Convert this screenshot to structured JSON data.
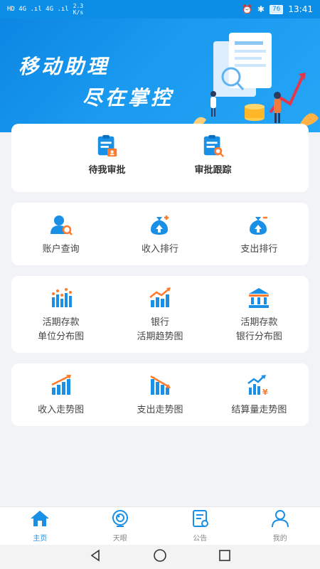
{
  "status": {
    "left_text": "HD 4G .ıl 4G .ıl",
    "speed": "2.3\nK/s",
    "battery": "76",
    "time": "13:41"
  },
  "banner": {
    "line1": "移动助理",
    "line2": "尽在掌控"
  },
  "approval": [
    {
      "label": "待我审批",
      "icon": "pending-approval-icon"
    },
    {
      "label": "审批跟踪",
      "icon": "approval-tracking-icon"
    }
  ],
  "row2": [
    {
      "label": "账户查询",
      "icon": "account-query-icon"
    },
    {
      "label": "收入排行",
      "icon": "income-ranking-icon"
    },
    {
      "label": "支出排行",
      "icon": "expense-ranking-icon"
    }
  ],
  "row3": [
    {
      "line1": "活期存款",
      "line2": "单位分布图",
      "icon": "bar-chart-icon"
    },
    {
      "line1": "银行",
      "line2": "活期趋势图",
      "icon": "trend-chart-icon"
    },
    {
      "line1": "活期存款",
      "line2": "银行分布图",
      "icon": "bank-icon"
    }
  ],
  "row4": [
    {
      "label": "收入走势图",
      "icon": "income-trend-icon"
    },
    {
      "label": "支出走势图",
      "icon": "expense-trend-icon"
    },
    {
      "label": "结算量走势图",
      "icon": "settlement-trend-icon"
    }
  ],
  "tabs": [
    {
      "label": "主页",
      "icon": "home-icon",
      "active": true
    },
    {
      "label": "天眼",
      "icon": "eye-icon",
      "active": false
    },
    {
      "label": "公告",
      "icon": "notice-icon",
      "active": false
    },
    {
      "label": "我的",
      "icon": "profile-icon",
      "active": false
    }
  ],
  "colors": {
    "primary": "#1a8fe6",
    "accent_orange": "#ff7a2a",
    "background": "#f1f3f7"
  }
}
